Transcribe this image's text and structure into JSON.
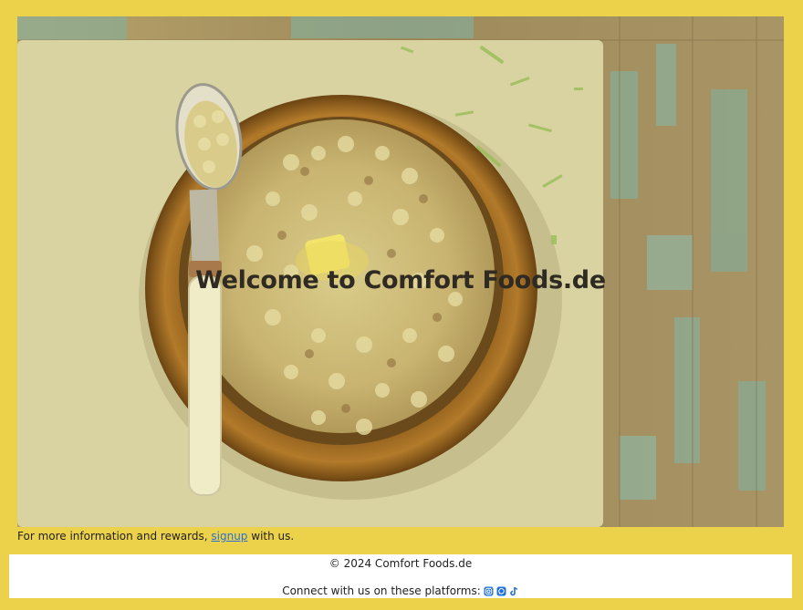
{
  "hero": {
    "title": "Welcome to Comfort Foods.de"
  },
  "info": {
    "prefix": "For more information and rewards,",
    "link_label": "signup",
    "suffix": "with us."
  },
  "footer": {
    "copyright": "© 2024 Comfort Foods.de",
    "connect_text": "Connect with us on these platforms:",
    "social": [
      {
        "icon": "instagram-icon",
        "color": "#1f6fd8"
      },
      {
        "icon": "whatsapp-icon",
        "color": "#1f6fd8"
      },
      {
        "icon": "tiktok-icon",
        "color": "#1f6fd8"
      }
    ]
  },
  "colors": {
    "page_background": "#ecd24a",
    "link": "#2a6fd6"
  }
}
